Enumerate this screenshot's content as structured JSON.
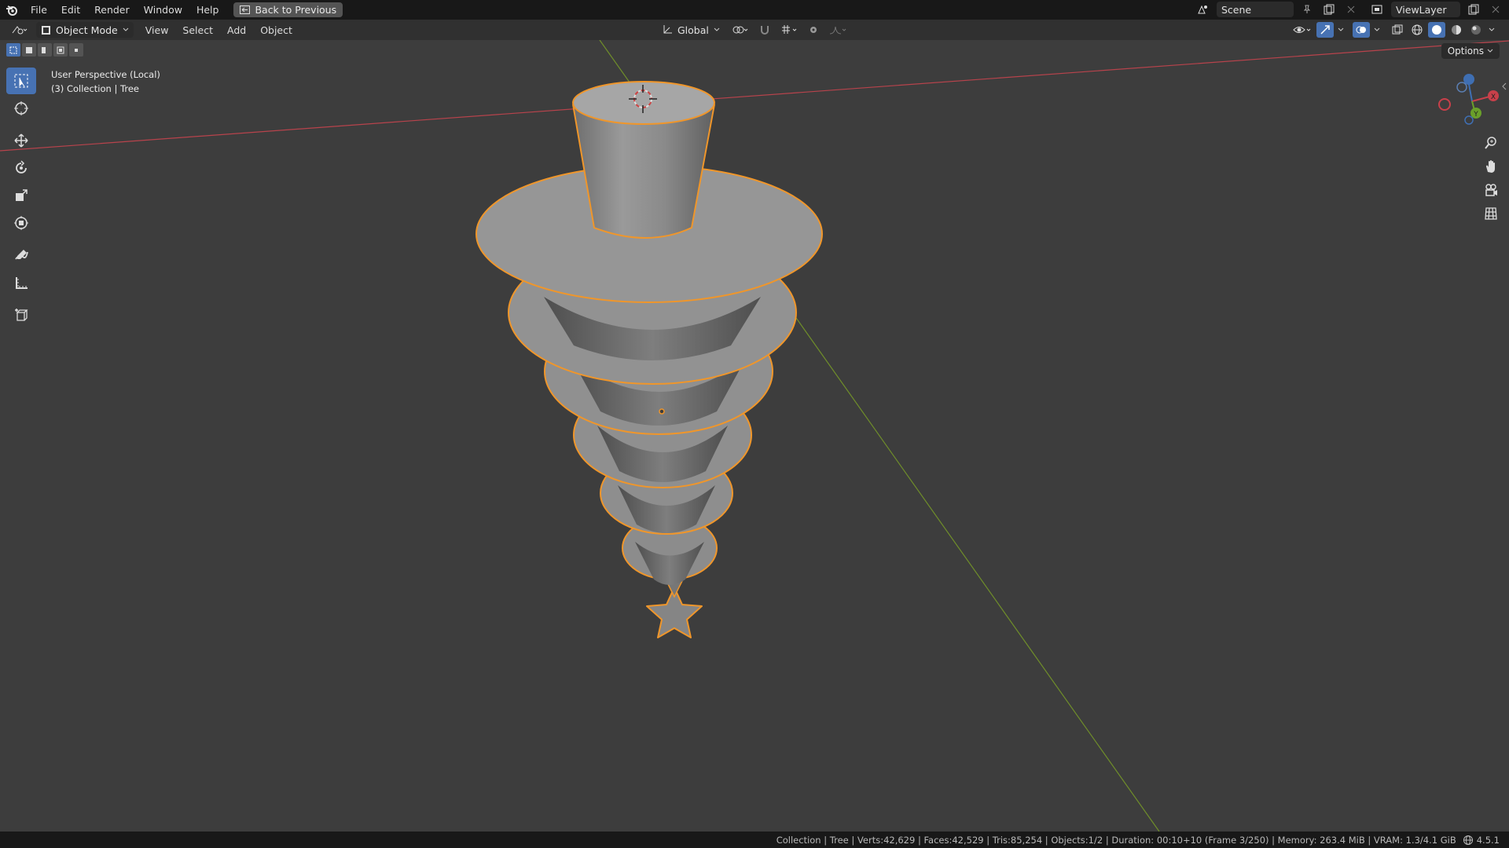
{
  "topbar": {
    "menus": [
      "File",
      "Edit",
      "Render",
      "Window",
      "Help"
    ],
    "back_button": "Back to Previous",
    "scene": "Scene",
    "view_layer": "ViewLayer"
  },
  "header": {
    "mode": "Object Mode",
    "menus": [
      "View",
      "Select",
      "Add",
      "Object"
    ],
    "orientation": "Global"
  },
  "viewport": {
    "perspective": "User Perspective (Local)",
    "collection": "(3) Collection | Tree",
    "options": "Options",
    "gizmo_labels": [
      "X",
      "Y"
    ]
  },
  "status": {
    "text": "Collection | Tree | Verts:42,629 | Faces:42,529 | Tris:85,254 | Objects:1/2 | Duration: 00:10+10 (Frame 3/250) | Memory: 263.4 MiB | VRAM: 1.3/4.1 GiB",
    "version": "4.5.1"
  },
  "colors": {
    "accent": "#4772b3",
    "selection_outline": "#f0962a",
    "x_axis": "#c8404a",
    "y_axis": "#7a9e2a"
  }
}
